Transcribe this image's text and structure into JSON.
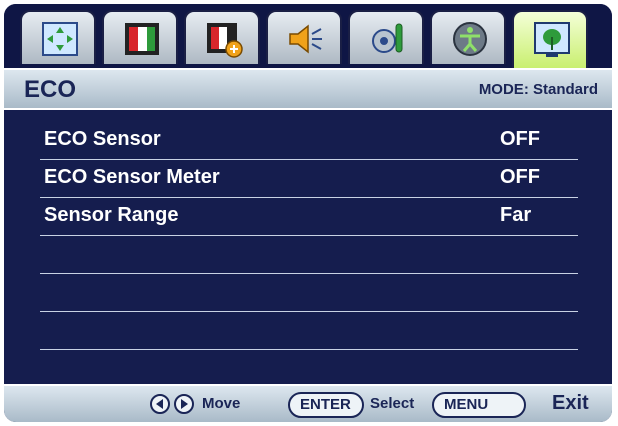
{
  "tabs": [
    {
      "icon": "display-icon",
      "active": false
    },
    {
      "icon": "picture-icon",
      "active": false
    },
    {
      "icon": "picture-advanced-icon",
      "active": false
    },
    {
      "icon": "audio-icon",
      "active": false
    },
    {
      "icon": "system-settings-icon",
      "active": false
    },
    {
      "icon": "accessibility-icon",
      "active": false
    },
    {
      "icon": "eco-icon",
      "active": true
    }
  ],
  "header": {
    "title": "ECO",
    "mode": "MODE: Standard"
  },
  "rows": [
    {
      "label": "ECO Sensor",
      "value": "OFF"
    },
    {
      "label": "ECO Sensor Meter",
      "value": "OFF"
    },
    {
      "label": "Sensor Range",
      "value": "Far"
    }
  ],
  "footer": {
    "enter_label": "ENTER",
    "select_label": "Select",
    "menu_label": "MENU",
    "move_label": "Move",
    "exit_label": "Exit"
  }
}
